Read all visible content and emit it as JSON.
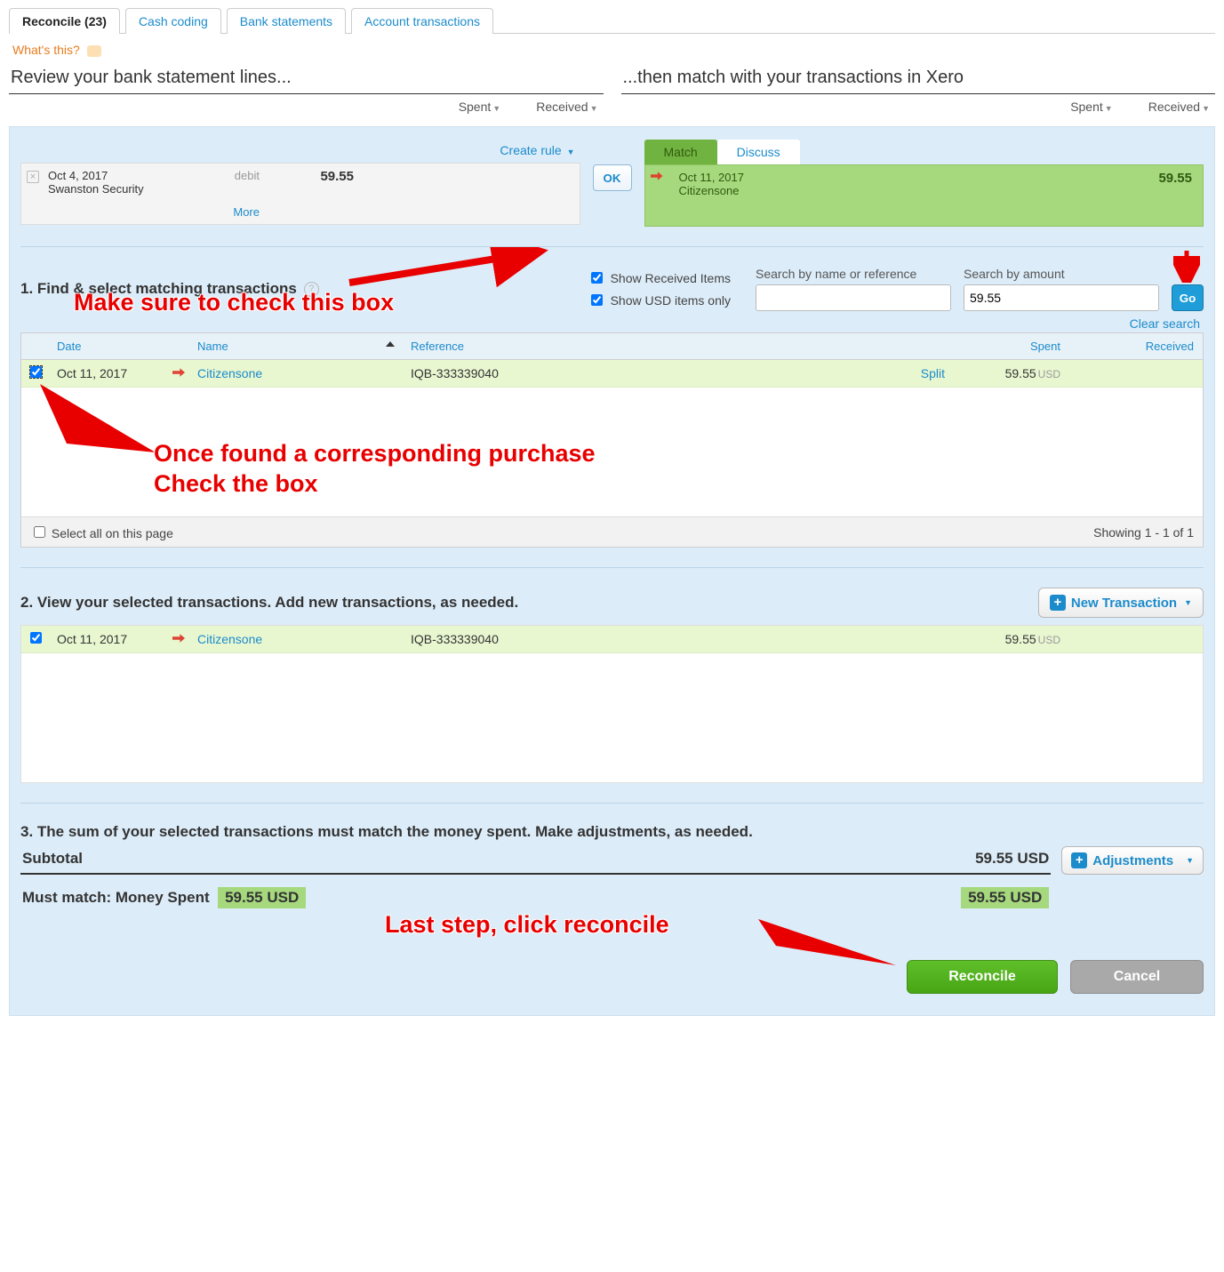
{
  "tabs": {
    "reconcile": "Reconcile (23)",
    "cash": "Cash coding",
    "bank": "Bank statements",
    "acct": "Account transactions"
  },
  "whats": "What's this?",
  "review": {
    "left": "Review your bank statement lines...",
    "right": "...then match with your transactions in Xero",
    "spent": "Spent",
    "received": "Received"
  },
  "createRule": "Create rule",
  "stmt": {
    "date": "Oct 4, 2017",
    "payee": "Swanston Security",
    "type": "debit",
    "amount": "59.55",
    "more": "More"
  },
  "ok": "OK",
  "matchTabs": {
    "match": "Match",
    "discuss": "Discuss"
  },
  "matched": {
    "date": "Oct 11, 2017",
    "name": "Citizensone",
    "amount": "59.55"
  },
  "sec1": {
    "title": "1. Find & select matching transactions",
    "showRec": "Show Received Items",
    "showUsd": "Show USD items only",
    "searchName": "Search by name or reference",
    "searchAmt": "Search by amount",
    "amtVal": "59.55",
    "go": "Go",
    "clear": "Clear search"
  },
  "cols": {
    "date": "Date",
    "name": "Name",
    "ref": "Reference",
    "split": "Split",
    "spent": "Spent",
    "received": "Received"
  },
  "row": {
    "date": "Oct 11, 2017",
    "name": "Citizensone",
    "ref": "IQB-333339040",
    "spent": "59.55",
    "cur": "USD"
  },
  "foot": {
    "selectAll": "Select all on this page",
    "showing": "Showing 1 - 1 of 1"
  },
  "sec2": {
    "title": "2. View your selected transactions. Add new transactions, as needed.",
    "newTrans": "New Transaction"
  },
  "sec3": {
    "title": "3. The sum of your selected transactions must match the money spent. Make adjustments, as needed.",
    "adj": "Adjustments",
    "subtotal": "Subtotal",
    "subval": "59.55 USD",
    "must": "Must match: Money Spent",
    "badge": "59.55 USD"
  },
  "actions": {
    "rec": "Reconcile",
    "cancel": "Cancel"
  },
  "anno": {
    "a1": "Make sure to check this box",
    "a2": "Once found a corresponding purchase\nCheck the box",
    "a3": "Last step, click reconcile"
  }
}
